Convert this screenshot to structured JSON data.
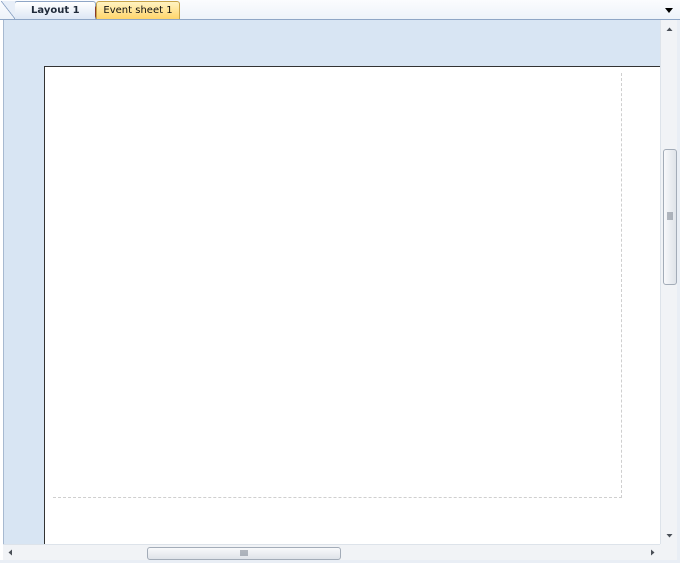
{
  "tabs": [
    {
      "label": "Layout 1",
      "active": true
    },
    {
      "label": "Event sheet 1",
      "active": false
    }
  ],
  "icons": {
    "tab_close": "close-icon",
    "tab_menu": "chevron-down-icon",
    "scroll_up": "arrow-up-icon",
    "scroll_down": "arrow-down-icon",
    "scroll_left": "arrow-left-icon",
    "scroll_right": "arrow-right-icon"
  },
  "colors": {
    "outside_layout": "#d8e5f3",
    "layout_background": "#ffffff",
    "active_tab_accent": "#ffd56b"
  }
}
